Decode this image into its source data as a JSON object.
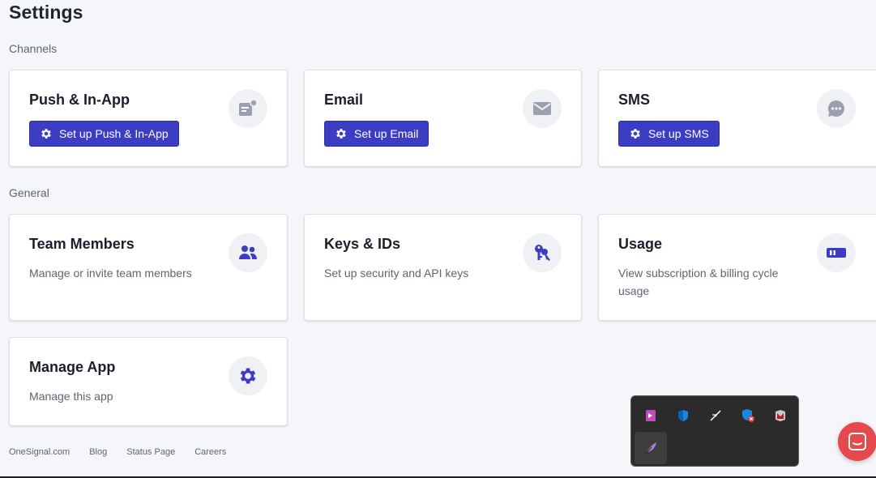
{
  "page": {
    "title": "Settings"
  },
  "sections": {
    "channels_label": "Channels",
    "general_label": "General"
  },
  "channels": [
    {
      "title": "Push & In-App",
      "button": "Set up Push & In-App",
      "icon": "push-notification-icon"
    },
    {
      "title": "Email",
      "button": "Set up Email",
      "icon": "envelope-icon"
    },
    {
      "title": "SMS",
      "button": "Set up SMS",
      "icon": "chat-bubble-icon"
    }
  ],
  "general": [
    {
      "title": "Team Members",
      "desc": "Manage or invite team members",
      "icon": "people-icon"
    },
    {
      "title": "Keys & IDs",
      "desc": "Set up security and API keys",
      "icon": "keys-icon"
    },
    {
      "title": "Usage",
      "desc": "View subscription & billing cycle usage",
      "icon": "usage-meter-icon"
    },
    {
      "title": "Manage App",
      "desc": "Manage this app",
      "icon": "gear-icon"
    }
  ],
  "footer": {
    "links": [
      "OneSignal.com",
      "Blog",
      "Status Page",
      "Careers"
    ]
  },
  "colors": {
    "accent": "#3d3dc4",
    "chat": "#e5484d"
  }
}
